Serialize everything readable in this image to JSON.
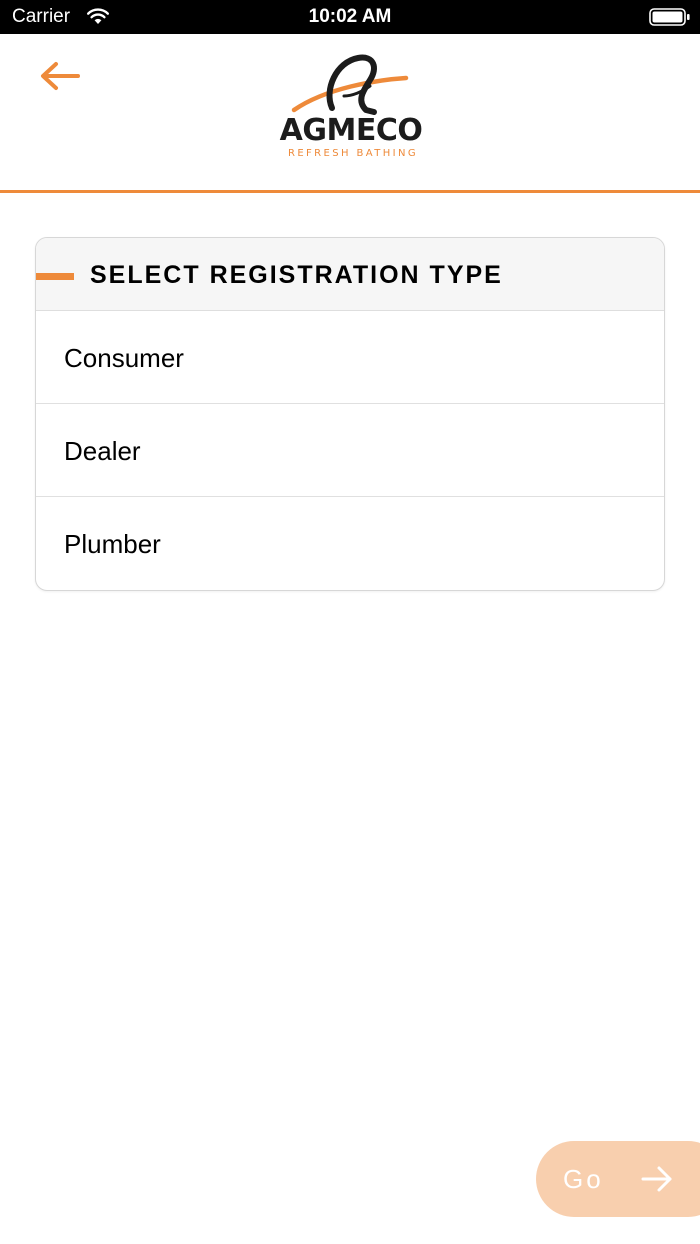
{
  "status_bar": {
    "carrier": "Carrier",
    "time": "10:02 AM",
    "icons": [
      "wifi-icon",
      "battery-icon"
    ]
  },
  "header": {
    "back_icon": "arrow-left-icon",
    "logo": {
      "wordmark": "AGMECO",
      "tagline": "REFRESH BATHING"
    }
  },
  "registration": {
    "title": "SELECT REGISTRATION TYPE",
    "options": [
      {
        "label": "Consumer"
      },
      {
        "label": "Dealer"
      },
      {
        "label": "Plumber"
      }
    ]
  },
  "footer": {
    "go_label": "Go",
    "go_icon": "arrow-right-icon"
  },
  "colors": {
    "accent": "#ee8a3a",
    "go_button_disabled": "#f8cfae",
    "card_header_bg": "#f6f6f6",
    "status_bar_bg": "#000000"
  }
}
